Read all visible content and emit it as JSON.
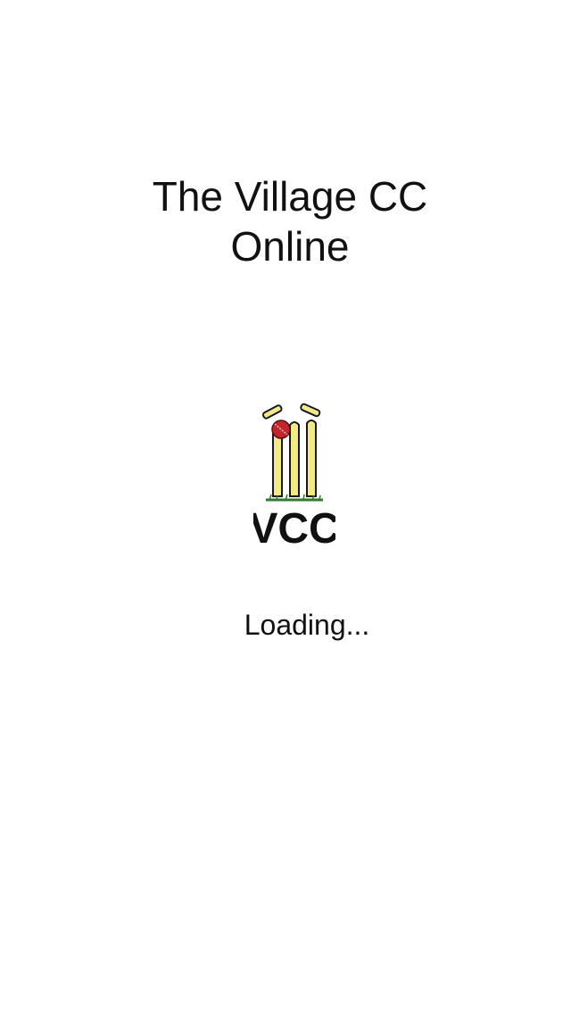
{
  "splash": {
    "title_line1": "The Village CC",
    "title_line2": "Online",
    "logo": {
      "text": "VCC",
      "icon": "cricket-stumps-ball-icon",
      "colors": {
        "stumps": "#f2e98c",
        "outline": "#1a1a1a",
        "ball": "#c0262b",
        "grass": "#2f7a2f",
        "text": "#111111"
      }
    },
    "status": "Loading..."
  }
}
